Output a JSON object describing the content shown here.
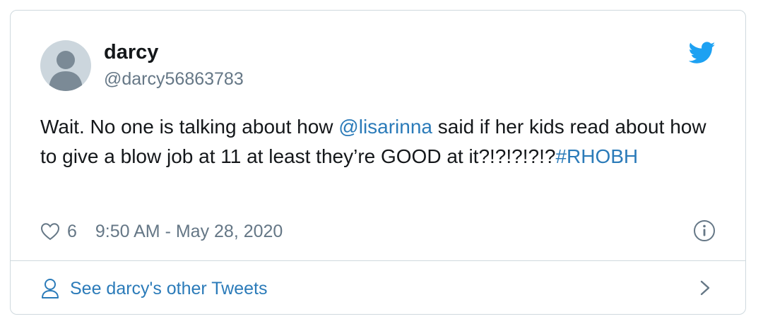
{
  "tweet": {
    "author_name": "darcy",
    "author_handle": "@darcy56863783",
    "text_before": "Wait.  No one is talking about how ",
    "mention": "@lisarinna",
    "text_middle": " said if her kids read about how to give a blow job at 11 at least they’re GOOD at it?!?!?!?!?",
    "hashtag": "#RHOBH",
    "like_count": "6",
    "timestamp": "9:50 AM - May 28, 2020"
  },
  "footer": {
    "link_label": "See darcy's other Tweets"
  },
  "icons": {
    "brand": "twitter-bird-icon",
    "like": "heart-icon",
    "info": "info-icon",
    "profile": "person-icon",
    "more": "chevron-right-icon"
  },
  "colors": {
    "link": "#2b7bb9",
    "twitter_blue": "#1da1f2",
    "secondary_text": "#657786",
    "border": "#cfd9de"
  }
}
